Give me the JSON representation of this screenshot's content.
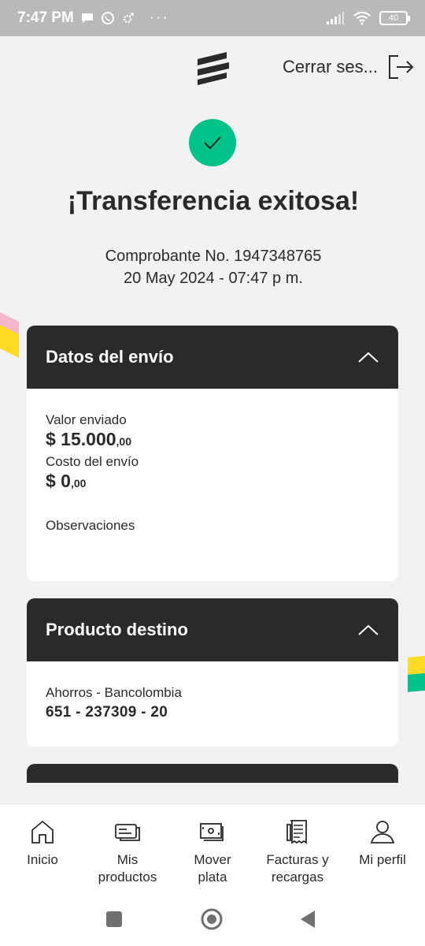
{
  "status_bar": {
    "time": "7:47 PM",
    "dots": "···",
    "battery": "40"
  },
  "header": {
    "logout_label": "Cerrar ses..."
  },
  "receipt": {
    "title": "¡Transferencia exitosa!",
    "voucher": "Comprobante No. 1947348765",
    "datetime": "20 May 2024 - 07:47 p m."
  },
  "shipping": {
    "title": "Datos del envío",
    "sent_label": "Valor enviado",
    "sent_main": "$ 15.000",
    "sent_cents": ",00",
    "cost_label": "Costo del envío",
    "cost_main": "$ 0",
    "cost_cents": ",00",
    "notes_label": "Observaciones"
  },
  "destination": {
    "title": "Producto destino",
    "account_type": "Ahorros - Bancolombia",
    "account_number": "651 - 237309 - 20"
  },
  "bottom_nav": [
    {
      "label": "Inicio",
      "icon": "home-icon"
    },
    {
      "label": "Mis\nproductos",
      "icon": "cards-icon"
    },
    {
      "label": "Mover\nplata",
      "icon": "money-icon"
    },
    {
      "label": "Facturas y\nrecargas",
      "icon": "receipt-icon"
    },
    {
      "label": "Mi perfil",
      "icon": "user-icon"
    }
  ],
  "colors": {
    "dark": "#2c2a29",
    "success": "#00c389",
    "yellow": "#fdda24",
    "pink": "#f5b6cd",
    "green": "#00c389"
  }
}
